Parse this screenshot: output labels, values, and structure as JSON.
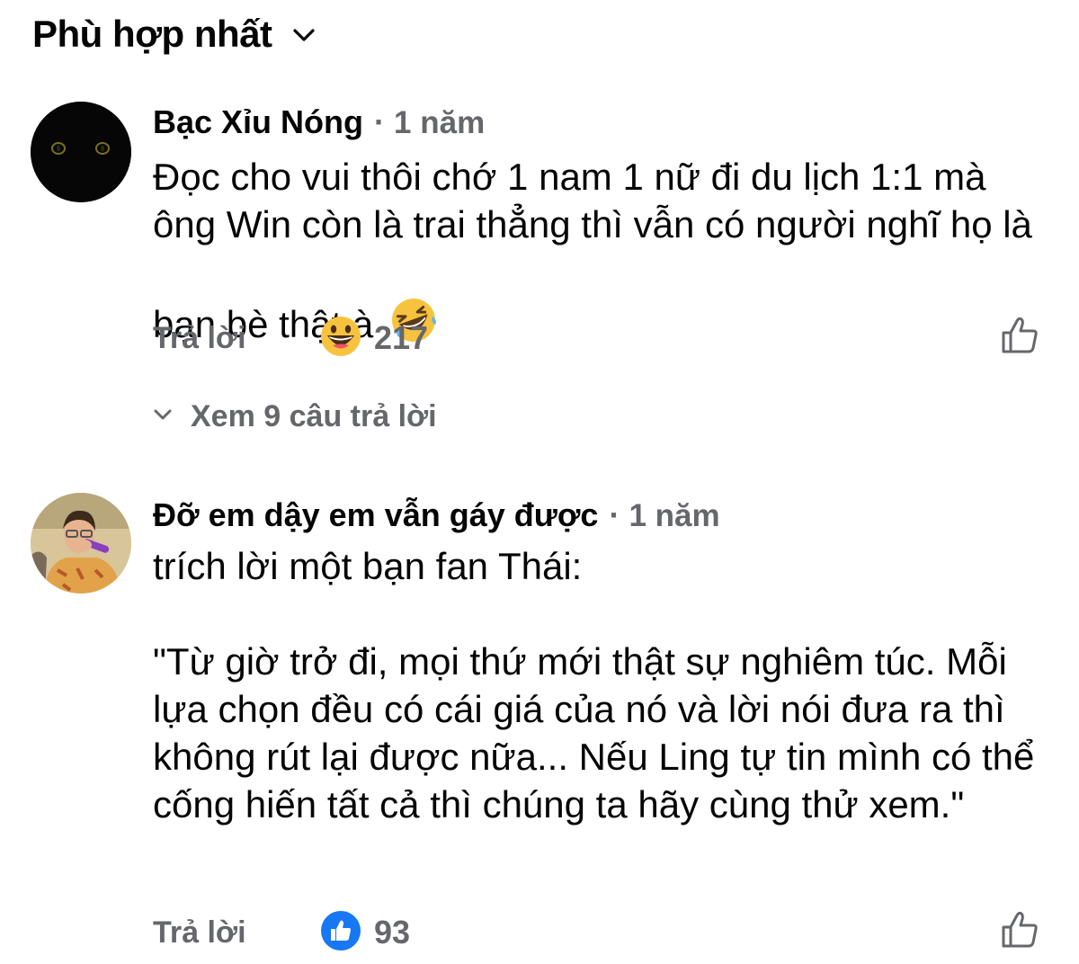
{
  "sort": {
    "label": "Phù hợp nhất",
    "icon": "chevron-down-icon"
  },
  "comments": [
    {
      "author": "Bạc Xỉu Nóng",
      "separator": "·",
      "time": "1 năm",
      "text": "Đọc cho vui thôi chớ 1 nam 1 nữ đi du lịch 1:1 mà ông Win còn là trai thẳng thì vẫn có người nghĩ họ là bạn bè thật à",
      "inline_emoji": "rolling-on-floor-laughing-emoji",
      "reply_label": "Trả lời",
      "reaction_icon": "haha-reaction-icon",
      "reaction_count": "217",
      "view_replies": "Xem 9 câu trả lời"
    },
    {
      "author": "Đỡ em dậy em vẫn gáy được",
      "separator": "·",
      "time": "1 năm",
      "text": "trích lời một bạn fan Thái:\n\n\"Từ giờ trở đi, mọi thứ mới thật sự nghiêm túc. Mỗi lựa chọn đều có cái giá của nó và lời nói đưa ra thì không rút lại được nữa... Nếu Ling tự tin mình có thể cống hiến tất cả thì chúng ta hãy cùng thử xem.\"",
      "reply_label": "Trả lời",
      "reaction_icon": "like-reaction-icon",
      "reaction_count": "93"
    }
  ],
  "colors": {
    "text": "#050505",
    "secondary": "#65676b",
    "like_blue": "#1877f2",
    "emoji_yellow": "#f7c33f"
  }
}
